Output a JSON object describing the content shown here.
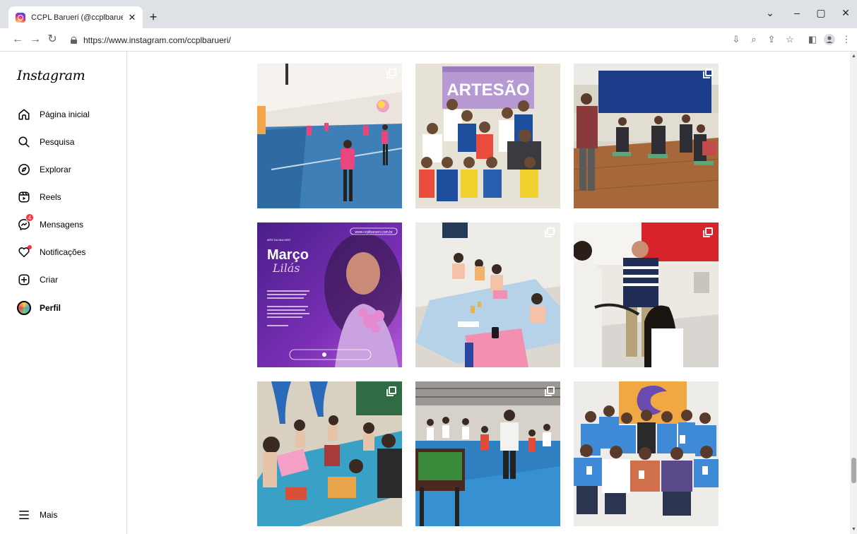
{
  "browser": {
    "tab_title": "CCPL Barueri (@ccplbarueri) • Fo",
    "tab_close": "✕",
    "new_tab": "+",
    "url": "https://www.instagram.com/ccplbarueri/",
    "window_controls": {
      "dropdown": "⌄",
      "minimize": "–",
      "restore": "▢",
      "close": "✕"
    }
  },
  "instagram": {
    "logo": "Instagram",
    "nav": [
      {
        "label": "Página inicial",
        "icon": "home-icon"
      },
      {
        "label": "Pesquisa",
        "icon": "search-icon"
      },
      {
        "label": "Explorar",
        "icon": "compass-icon"
      },
      {
        "label": "Reels",
        "icon": "reels-icon"
      },
      {
        "label": "Mensagens",
        "icon": "messenger-icon",
        "badge": "4"
      },
      {
        "label": "Notificações",
        "icon": "heart-icon"
      },
      {
        "label": "Criar",
        "icon": "plus-square-icon"
      },
      {
        "label": "Perfil",
        "icon": "avatar"
      }
    ],
    "more": "Mais"
  },
  "posts": [
    {
      "subject": "gym-dance",
      "multi": true
    },
    {
      "subject": "artesao-group",
      "banner": "ARTESÃO",
      "multi": false
    },
    {
      "subject": "meeting-room",
      "multi": true
    },
    {
      "subject": "marco-lilas",
      "title": "Março",
      "subtitle": "Lilás",
      "kicker": "MÊS DA MULHER",
      "site": "www.ccplbarueri.com.br",
      "multi": false
    },
    {
      "subject": "kids-table",
      "multi": true
    },
    {
      "subject": "hair-salon",
      "multi": true
    },
    {
      "subject": "crafts-class",
      "multi": true
    },
    {
      "subject": "foosball-court",
      "multi": true
    },
    {
      "subject": "group-photo",
      "multi": false
    }
  ],
  "colors": {
    "accent_badge": "#ff3040",
    "marco_purple": "#7a2fb5"
  }
}
